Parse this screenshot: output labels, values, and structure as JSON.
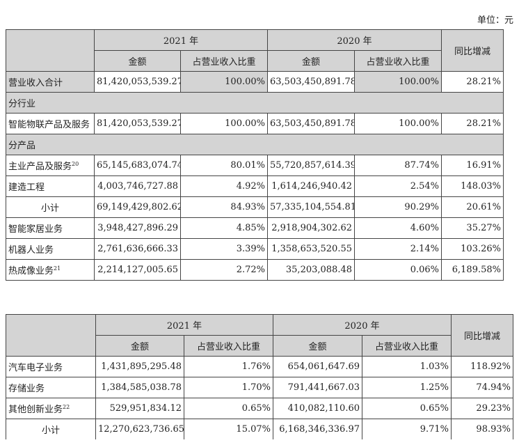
{
  "unit_label": "单位：元",
  "header": {
    "year_2021": "2021 年",
    "year_2020": "2020 年",
    "amount": "金额",
    "ratio": "占营业收入比重",
    "yoy": "同比增减"
  },
  "table1": {
    "total": {
      "label": "营业收入合计",
      "amt2021": "81,420,053,539.27",
      "pct2021": "100.00%",
      "amt2020": "63,503,450,891.78",
      "pct2020": "100.00%",
      "yoy": "28.21%"
    },
    "section_industry": "分行业",
    "industry_rows": [
      {
        "label": "智能物联产品及服务",
        "amt2021": "81,420,053,539.27",
        "pct2021": "100.00%",
        "amt2020": "63,503,450,891.78",
        "pct2020": "100.00%",
        "yoy": "28.21%"
      }
    ],
    "section_product": "分产品",
    "product_rows": [
      {
        "label": "主业产品及服务",
        "note": "20",
        "amt2021": "65,145,683,074.74",
        "pct2021": "80.01%",
        "amt2020": "55,720,857,614.39",
        "pct2020": "87.74%",
        "yoy": "16.91%"
      },
      {
        "label": "建造工程",
        "note": "",
        "amt2021": "4,003,746,727.88",
        "pct2021": "4.92%",
        "amt2020": "1,614,246,940.42",
        "pct2020": "2.54%",
        "yoy": "148.03%"
      },
      {
        "label": "小计",
        "note": "",
        "amt2021": "69,149,429,802.62",
        "pct2021": "84.93%",
        "amt2020": "57,335,104,554.81",
        "pct2020": "90.29%",
        "yoy": "20.61%"
      },
      {
        "label": "智能家居业务",
        "note": "",
        "amt2021": "3,948,427,896.29",
        "pct2021": "4.85%",
        "amt2020": "2,918,904,302.62",
        "pct2020": "4.60%",
        "yoy": "35.27%"
      },
      {
        "label": "机器人业务",
        "note": "",
        "amt2021": "2,761,636,666.33",
        "pct2021": "3.39%",
        "amt2020": "1,358,653,520.55",
        "pct2020": "2.14%",
        "yoy": "103.26%"
      },
      {
        "label": "热成像业务",
        "note": "21",
        "amt2021": "2,214,127,005.65",
        "pct2021": "2.72%",
        "amt2020": "35,203,088.48",
        "pct2020": "0.06%",
        "yoy": "6,189.58%"
      }
    ]
  },
  "table2": {
    "rows": [
      {
        "label": "汽车电子业务",
        "note": "",
        "amt2021": "1,431,895,295.48",
        "pct2021": "1.76%",
        "amt2020": "654,061,647.69",
        "pct2020": "1.03%",
        "yoy": "118.92%"
      },
      {
        "label": "存储业务",
        "note": "",
        "amt2021": "1,384,585,038.78",
        "pct2021": "1.70%",
        "amt2020": "791,441,667.03",
        "pct2020": "1.25%",
        "yoy": "74.94%"
      },
      {
        "label": "其他创新业务",
        "note": "22",
        "amt2021": "529,951,834.12",
        "pct2021": "0.65%",
        "amt2020": "410,082,110.60",
        "pct2020": "0.65%",
        "yoy": "29.23%"
      },
      {
        "label": "小计",
        "note": "",
        "amt2021": "12,270,623,736.65",
        "pct2021": "15.07%",
        "amt2020": "6,168,346,336.97",
        "pct2020": "9.71%",
        "yoy": "98.93%"
      }
    ]
  }
}
